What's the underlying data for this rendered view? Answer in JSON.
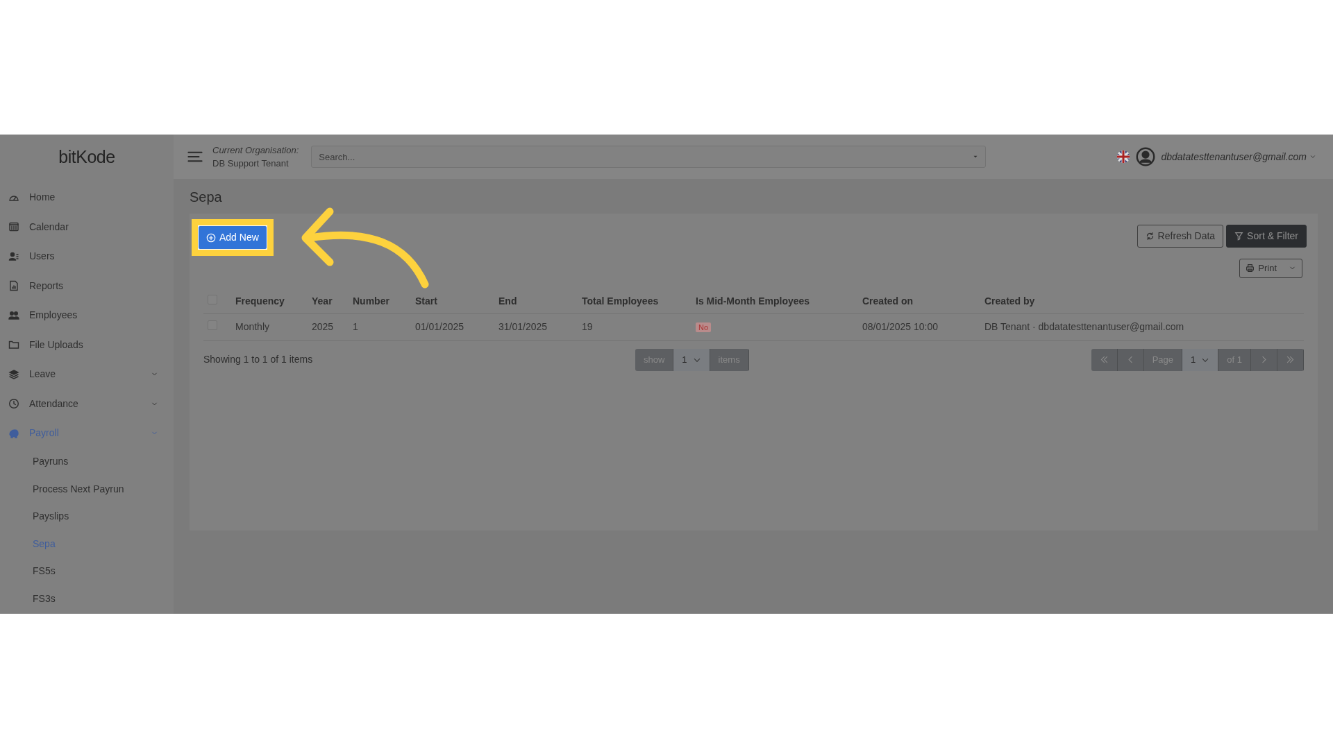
{
  "brand": "bitKode",
  "sidebar": {
    "items": [
      {
        "label": "Home",
        "kind": "link",
        "selected": false
      },
      {
        "label": "Calendar",
        "kind": "link",
        "selected": false
      },
      {
        "label": "Users",
        "kind": "link",
        "selected": false
      },
      {
        "label": "Reports",
        "kind": "link",
        "selected": false
      },
      {
        "label": "Employees",
        "kind": "link",
        "selected": false
      },
      {
        "label": "File Uploads",
        "kind": "link",
        "selected": false
      },
      {
        "label": "Leave",
        "kind": "group",
        "selected": false
      },
      {
        "label": "Attendance",
        "kind": "group",
        "selected": false
      },
      {
        "label": "Payroll",
        "kind": "group",
        "selected": true,
        "children": [
          {
            "label": "Payruns",
            "selected": false
          },
          {
            "label": "Process Next Payrun",
            "selected": false
          },
          {
            "label": "Payslips",
            "selected": false
          },
          {
            "label": "Sepa",
            "selected": true
          },
          {
            "label": "FS5s",
            "selected": false
          },
          {
            "label": "FS3s",
            "selected": false
          }
        ]
      }
    ]
  },
  "header": {
    "org_label": "Current Organisation:",
    "org_name": "DB Support Tenant",
    "search": {
      "placeholder": "Search..."
    },
    "user": "dbdatatesttenantuser@gmail.com"
  },
  "page_title": "Sepa",
  "toolbar": {
    "add_button": "Add New",
    "refresh_button": "Refresh Data",
    "filter_button": "Sort & Filter",
    "print_button": "Print"
  },
  "table": {
    "select_all_checked": false,
    "columns": [
      "Frequency",
      "Year",
      "Number",
      "Start",
      "End",
      "Total Employees",
      "Is Mid-Month Employees",
      "Created on",
      "Created by"
    ],
    "rows": [
      {
        "checked": false,
        "cells": [
          "Monthly",
          "2025",
          "1",
          "01/01/2025",
          "31/01/2025",
          "19",
          "No",
          "08/01/2025 10:00",
          "DB Tenant · dbdatatesttenantuser@gmail.com"
        ]
      }
    ]
  },
  "footer": {
    "summary": "Showing 1 to 1 of 1 items",
    "show_label": "show",
    "page_size": "1",
    "items_label": "items",
    "page_label": "Page",
    "page": "1",
    "of_label": "of 1"
  }
}
